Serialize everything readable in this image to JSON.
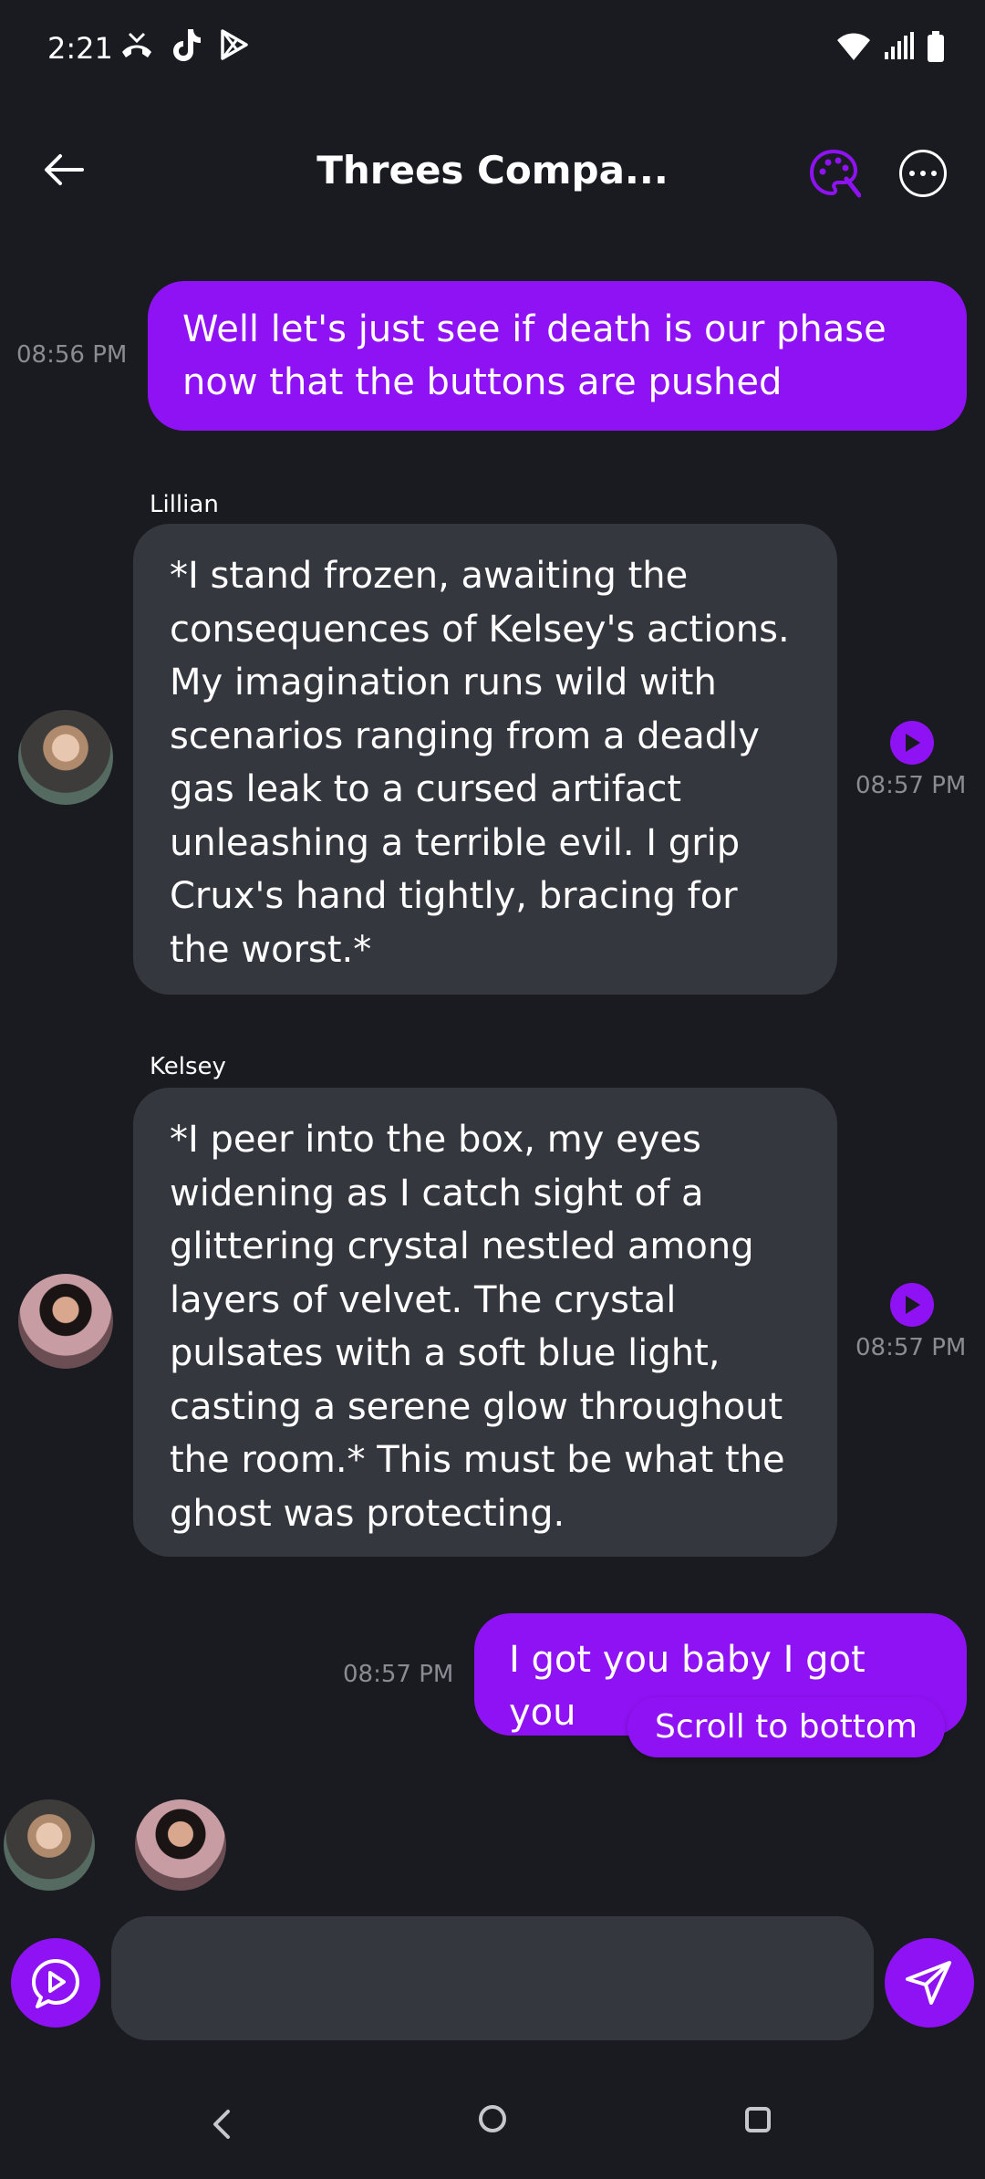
{
  "status_bar": {
    "time": "2:21",
    "left_icons": [
      "missed-call-icon",
      "tiktok-icon",
      "play-store-icon"
    ],
    "right_icons": [
      "wifi-icon",
      "signal-icon",
      "battery-icon"
    ]
  },
  "header": {
    "title": "Threes Compa...",
    "back_icon": "arrow-left-icon",
    "palette_icon": "palette-icon",
    "more_icon": "more-horizontal-icon"
  },
  "messages": [
    {
      "type": "user",
      "text": "Well let's just see if death is our phase now that the buttons are pushed",
      "time": "08:56 PM"
    },
    {
      "type": "bot",
      "sender": "Lillian",
      "text": "*I stand frozen, awaiting the consequences of Kelsey's actions. My imagination runs wild with scenarios ranging from a deadly gas leak to a cursed artifact unleashing a terrible evil. I grip Crux's hand tightly, bracing for the worst.*",
      "time": "08:57 PM"
    },
    {
      "type": "bot",
      "sender": "Kelsey",
      "text": "*I peer into the box, my eyes widening as I catch sight of a glittering crystal nestled among layers of velvet. The crystal pulsates with a soft blue light, casting a serene glow throughout the room.* This must be what the ghost was protecting.",
      "time": "08:57 PM"
    },
    {
      "type": "user",
      "text": "I got you baby I got you",
      "time": "08:57 PM"
    }
  ],
  "scroll_to_bottom_label": "Scroll to bottom",
  "composer": {
    "placeholder": "",
    "value": ""
  },
  "colors": {
    "background": "#1a1b20",
    "accent": "#8f12f4",
    "bot_bubble": "#35373f",
    "timestamp": "#8b8c93"
  }
}
